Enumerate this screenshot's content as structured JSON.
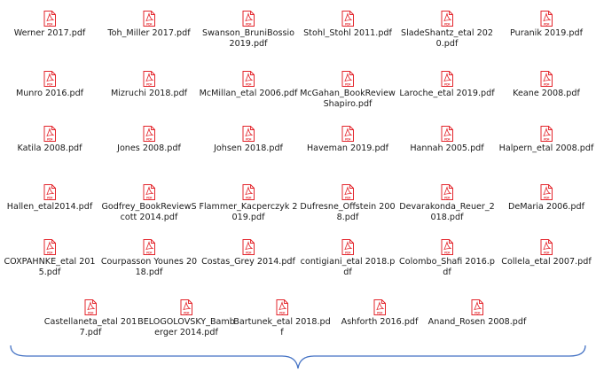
{
  "colors": {
    "pdf_red": "#e3242b",
    "text": "#1a1a1a",
    "brace": "#4472c4"
  },
  "icons": {
    "file_icon": "pdf-file-icon",
    "file_icon_badge": "PDF"
  },
  "files": [
    "Werner 2017.pdf",
    "Toh_Miller 2017.pdf",
    "Swanson_BruniBossio 2019.pdf",
    "Stohl_Stohl 2011.pdf",
    "SladeShantz_etal 2020.pdf",
    "Puranik 2019.pdf",
    "Munro 2016.pdf",
    "Mizruchi 2018.pdf",
    "McMillan_etal 2006.pdf",
    "McGahan_BookReviewShapiro.pdf",
    "Laroche_etal 2019.pdf",
    "Keane 2008.pdf",
    "Katila 2008.pdf",
    "Jones 2008.pdf",
    "Johsen 2018.pdf",
    "Haveman 2019.pdf",
    "Hannah 2005.pdf",
    "Halpern_etal 2008.pdf",
    "Hallen_etal2014.pdf",
    "Godfrey_BookReviewScott 2014.pdf",
    "Flammer_Kacperczyk 2019.pdf",
    "Dufresne_Offstein 2008.pdf",
    "Devarakonda_Reuer_2018.pdf",
    "DeMaria 2006.pdf",
    "COXPAHNKE_etal 2015.pdf",
    "Courpasson Younes 2018.pdf",
    "Costas_Grey 2014.pdf",
    "contigiani_etal 2018.pdf",
    "Colombo_Shafi 2016.pdf",
    "Collela_etal 2007.pdf",
    "Castellaneta_etal 2017.pdf",
    "BELOGOLOVSKY_Bamberger 2014.pdf",
    "Bartunek_etal 2018.pdf",
    "Ashforth 2016.pdf",
    "Anand_Rosen 2008.pdf"
  ]
}
